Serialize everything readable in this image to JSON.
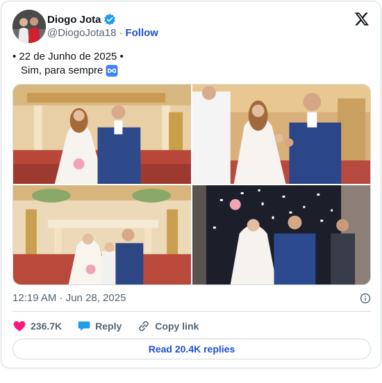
{
  "author": {
    "name": "Diogo Jota",
    "handle": "@DiogoJota18",
    "separator": "·",
    "follow_label": "Follow"
  },
  "tweet": {
    "line1": "• 22 de Junho de 2025 •",
    "line2": "Sim, para sempre",
    "emoji": "infinity-icon"
  },
  "media": {
    "photos": [
      "wedding-altar-portrait",
      "wedding-ring-celebration",
      "wedding-altar-with-child",
      "wedding-confetti-exit"
    ]
  },
  "meta": {
    "timestamp": "12:19 AM · Jun 28, 2025"
  },
  "actions": {
    "likes": "236.7K",
    "reply_label": "Reply",
    "copy_link_label": "Copy link"
  },
  "footer": {
    "read_replies": "Read 20.4K replies"
  },
  "colors": {
    "accent": "#1d9bf0",
    "link": "#1d4ed8",
    "like": "#f91880",
    "muted": "#536471"
  }
}
